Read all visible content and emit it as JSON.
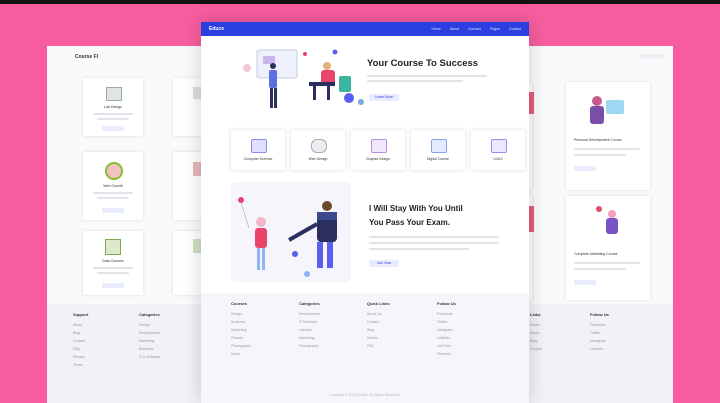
{
  "left_page": {
    "brand": "Course FI",
    "cards": [
      {
        "label": "Lab Design"
      },
      {
        "label": "Web Growth"
      },
      {
        "label": "Data Courses"
      }
    ],
    "footer_cols": [
      {
        "heading": "Support",
        "items": [
          "About",
          "Blog",
          "Contact",
          "FAQ",
          "Privacy",
          "Terms"
        ]
      },
      {
        "heading": "Categories",
        "items": [
          "Design",
          "Development",
          "Marketing",
          "Business",
          "IT & Software"
        ]
      }
    ]
  },
  "center_page": {
    "logo": "Educe",
    "nav_links": [
      "Home",
      "About",
      "Courses",
      "Pages",
      "Contact"
    ],
    "hero_title": "Your Course To Success",
    "hero_button": "Learn More",
    "features": [
      {
        "label": "Computer Science",
        "color": "#dfe1ff"
      },
      {
        "label": "Web Design",
        "color": "#ececf3"
      },
      {
        "label": "Graphic Design",
        "color": "#f1e6fb"
      },
      {
        "label": "Digital Course",
        "color": "#e4ebff"
      },
      {
        "label": "UI/UX",
        "color": "#ece8ff"
      }
    ],
    "section2_title_line1": "I Will Stay With You Until",
    "section2_title_line2": "You Pass Your Exam.",
    "section2_button": "Join Now",
    "footer_cols": [
      {
        "heading": "Courses",
        "items": [
          "Design",
          "Business",
          "Marketing",
          "Finance",
          "Photography",
          "Music"
        ]
      },
      {
        "heading": "Categories",
        "items": [
          "Development",
          "IT Software",
          "Lifestyle",
          "Marketing",
          "Photography"
        ]
      },
      {
        "heading": "Quick Links",
        "items": [
          "About Us",
          "Contact",
          "Blog",
          "Events",
          "FAQ"
        ]
      },
      {
        "heading": "Follow Us",
        "items": [
          "Facebook",
          "Twitter",
          "Instagram",
          "LinkedIn",
          "YouTube",
          "Pinterest"
        ]
      }
    ],
    "copyright": "Copyright © 2020 Educe. All Rights Reserved."
  },
  "right_page": {
    "cards": [
      {
        "label": "Personal Development Course"
      },
      {
        "label": "Complete Marketing Course"
      }
    ],
    "footer_cols": [
      {
        "heading": "Links",
        "items": [
          "Home",
          "About",
          "Blog",
          "Contact"
        ]
      },
      {
        "heading": "Follow Us",
        "items": [
          "Facebook",
          "Twitter",
          "Instagram",
          "LinkedIn"
        ]
      }
    ]
  },
  "colors": {
    "background": "#f75d9f",
    "nav": "#2b3fe0",
    "accent": "#5b5ff0"
  }
}
